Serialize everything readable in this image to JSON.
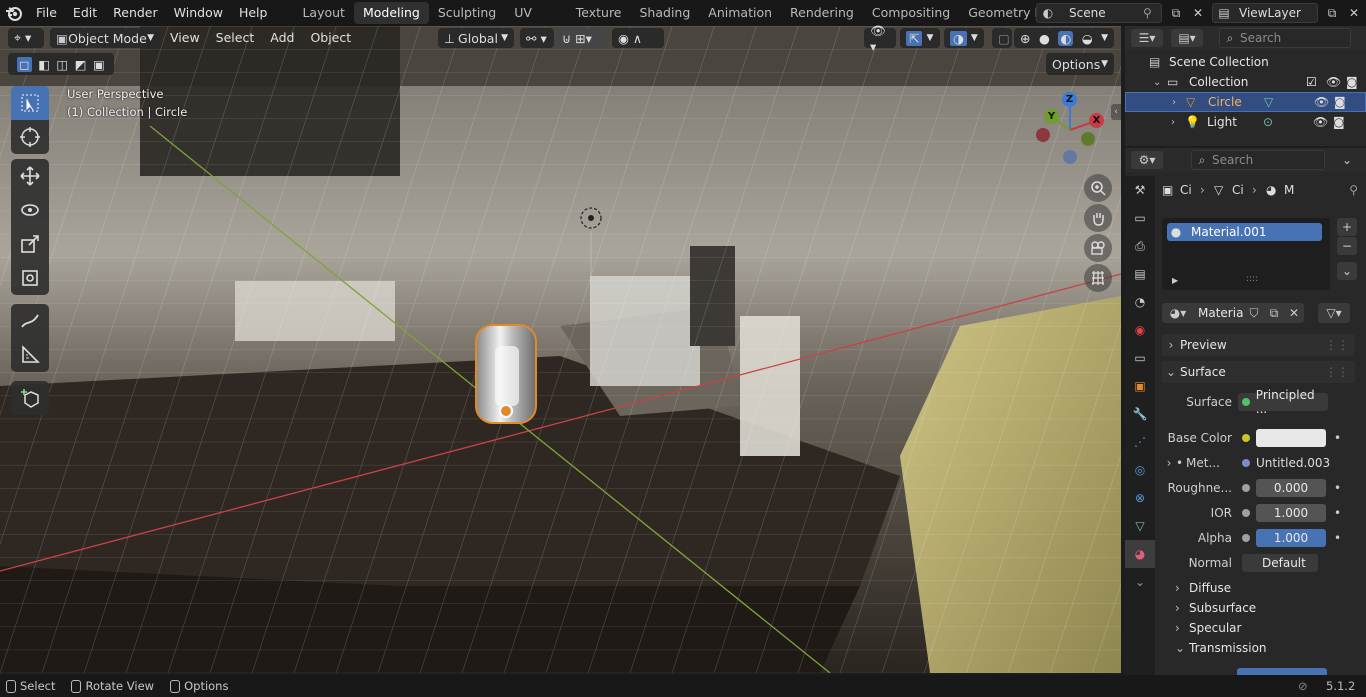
{
  "menu": [
    "File",
    "Edit",
    "Render",
    "Window",
    "Help"
  ],
  "workspaces": [
    "Layout",
    "Modeling",
    "Sculpting",
    "UV Editing",
    "Texture Paint",
    "Shading",
    "Animation",
    "Rendering",
    "Compositing",
    "Geometry Nodes"
  ],
  "active_workspace": "Modeling",
  "scene_name": "Scene",
  "view_layer": "ViewLayer",
  "viewport_header": {
    "mode": "Object Mode",
    "menus": [
      "View",
      "Select",
      "Add",
      "Object"
    ],
    "transform_orientation": "Global",
    "options_label": "Options"
  },
  "overlay_text": {
    "perspective": "User Perspective",
    "context": "(1) Collection | Circle"
  },
  "gizmo": {
    "x": "X",
    "y": "Y",
    "z": "Z",
    "x_color": "#c83a45",
    "y_color": "#6f9e2a",
    "z_color": "#3b7ad6"
  },
  "outliner": {
    "search_placeholder": "Search",
    "scene_collection": "Scene Collection",
    "collection": "Collection",
    "objects": [
      {
        "name": "Circle",
        "selected": true
      },
      {
        "name": "Light",
        "selected": false
      }
    ]
  },
  "properties": {
    "search_placeholder": "Search",
    "breadcrumb": [
      "Ci",
      "Ci",
      "M"
    ],
    "material_slot": "Material.001",
    "material_name": "Materia...",
    "panels": {
      "preview": "Preview",
      "surface": "Surface",
      "diffuse": "Diffuse",
      "subsurface": "Subsurface",
      "specular": "Specular",
      "transmission": "Transmission"
    },
    "rows": {
      "surface": {
        "label": "Surface",
        "value": "Principled ..."
      },
      "base_color": {
        "label": "Base Color",
        "value_color": "#e8e8e8"
      },
      "metallic": {
        "label": "Met...",
        "value": "Untitled.003"
      },
      "roughness": {
        "label": "Roughne...",
        "value": "0.000"
      },
      "ior": {
        "label": "IOR",
        "value": "1.000"
      },
      "alpha": {
        "label": "Alpha",
        "value": "1.000"
      },
      "normal": {
        "label": "Normal",
        "value": "Default"
      }
    }
  },
  "statusbar": {
    "select": "Select",
    "rotate": "Rotate View",
    "options": "Options",
    "version": "5.1.2"
  },
  "colors": {
    "accent": "#4772b3",
    "selection": "#e08a2c",
    "header_bg": "#181818",
    "panel_bg": "#282828"
  }
}
